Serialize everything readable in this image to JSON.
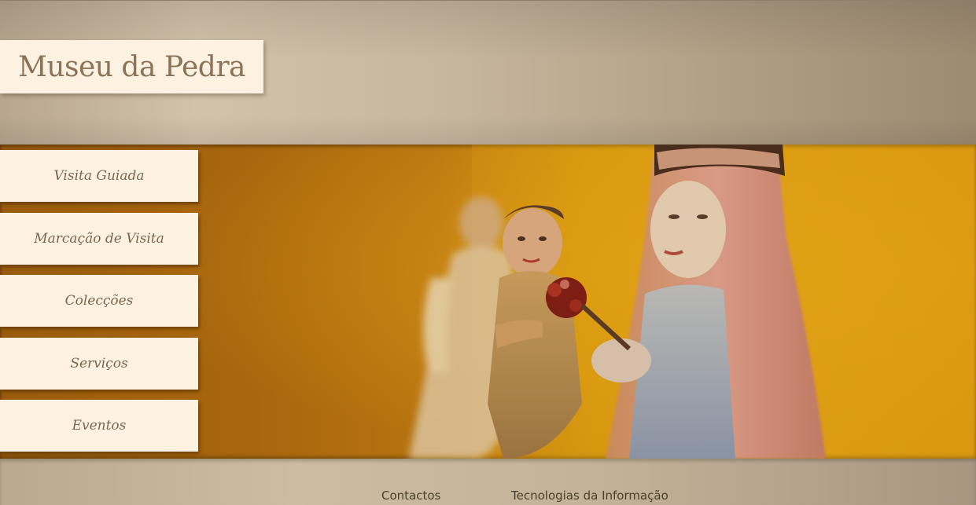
{
  "site": {
    "title": "Museu da Pedra"
  },
  "nav": {
    "items": [
      {
        "label": "Visita Guiada"
      },
      {
        "label": "Marcação de Visita"
      },
      {
        "label": "Colecções"
      },
      {
        "label": "Serviços"
      },
      {
        "label": "Eventos"
      }
    ]
  },
  "hero": {
    "image": "painted-stone-statues-of-madonna-and-child-photo"
  },
  "footer": {
    "links": [
      {
        "label": "Contactos"
      },
      {
        "label": "Tecnologias da Informação"
      }
    ]
  },
  "colors": {
    "menu_background": "#fdf2e1",
    "menu_text": "#7a6650",
    "hero_orange": "#dc9d14",
    "header_tan": "#d3c2aa"
  }
}
